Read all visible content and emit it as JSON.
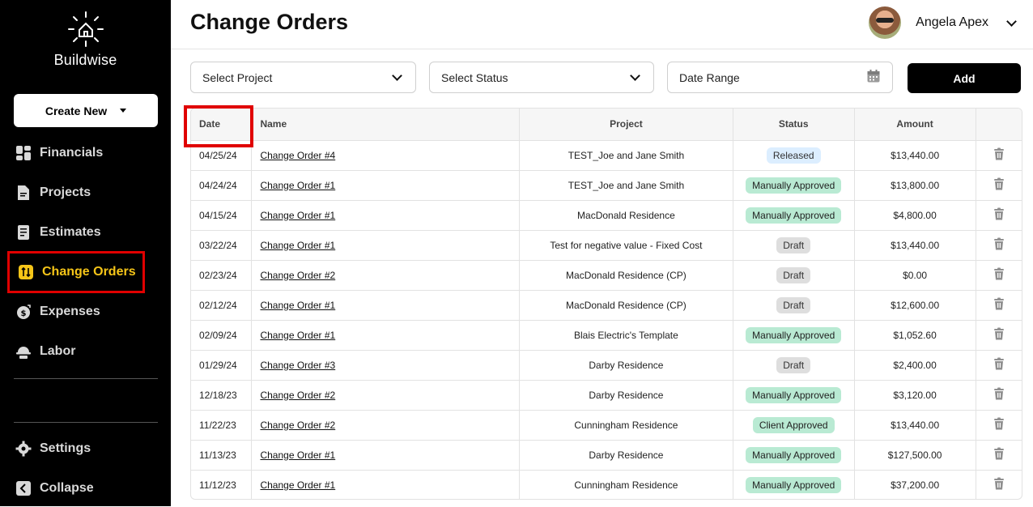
{
  "sidebar": {
    "brand": "Buildwise",
    "create_new": "Create New",
    "items": [
      {
        "label": "Financials",
        "icon": "grid-icon"
      },
      {
        "label": "Projects",
        "icon": "document-icon"
      },
      {
        "label": "Estimates",
        "icon": "estimate-icon"
      },
      {
        "label": "Change Orders",
        "icon": "change-orders-icon",
        "active": true
      },
      {
        "label": "Expenses",
        "icon": "money-bag-icon"
      },
      {
        "label": "Labor",
        "icon": "hard-hat-icon"
      }
    ],
    "settings": "Settings",
    "collapse": "Collapse"
  },
  "header": {
    "title": "Change Orders",
    "user_name": "Angela Apex"
  },
  "filters": {
    "project": "Select Project",
    "status": "Select Status",
    "date_range": "Date Range",
    "add": "Add"
  },
  "table": {
    "columns": [
      "Date",
      "Name",
      "Project",
      "Status",
      "Amount"
    ],
    "rows": [
      {
        "date": "04/25/24",
        "name": "Change Order #4",
        "project": "TEST_Joe and Jane Smith",
        "status": "Released",
        "amount": "$13,440.00"
      },
      {
        "date": "04/24/24",
        "name": "Change Order #1",
        "project": "TEST_Joe and Jane Smith",
        "status": "Manually Approved",
        "amount": "$13,800.00"
      },
      {
        "date": "04/15/24",
        "name": "Change Order #1",
        "project": "MacDonald Residence",
        "status": "Manually Approved",
        "amount": "$4,800.00"
      },
      {
        "date": "03/22/24",
        "name": "Change Order #1",
        "project": "Test for negative value - Fixed Cost",
        "status": "Draft",
        "amount": "$13,440.00"
      },
      {
        "date": "02/23/24",
        "name": "Change Order #2",
        "project": "MacDonald Residence (CP)",
        "status": "Draft",
        "amount": "$0.00"
      },
      {
        "date": "02/12/24",
        "name": "Change Order #1",
        "project": "MacDonald Residence (CP)",
        "status": "Draft",
        "amount": "$12,600.00"
      },
      {
        "date": "02/09/24",
        "name": "Change Order #1",
        "project": "Blais Electric's Template",
        "status": "Manually Approved",
        "amount": "$1,052.60"
      },
      {
        "date": "01/29/24",
        "name": "Change Order #3",
        "project": "Darby Residence",
        "status": "Draft",
        "amount": "$2,400.00"
      },
      {
        "date": "12/18/23",
        "name": "Change Order #2",
        "project": "Darby Residence",
        "status": "Manually Approved",
        "amount": "$3,120.00"
      },
      {
        "date": "11/22/23",
        "name": "Change Order #2",
        "project": "Cunningham Residence",
        "status": "Client Approved",
        "amount": "$13,440.00"
      },
      {
        "date": "11/13/23",
        "name": "Change Order #1",
        "project": "Darby Residence",
        "status": "Manually Approved",
        "amount": "$127,500.00"
      },
      {
        "date": "11/12/23",
        "name": "Change Order #1",
        "project": "Cunningham Residence",
        "status": "Manually Approved",
        "amount": "$37,200.00"
      }
    ]
  },
  "colors": {
    "active_nav": "#f5c518",
    "highlight_box": "#e00000",
    "badge_approved": "#b9ead3",
    "badge_released": "#dceeff",
    "badge_draft": "#dedede"
  }
}
